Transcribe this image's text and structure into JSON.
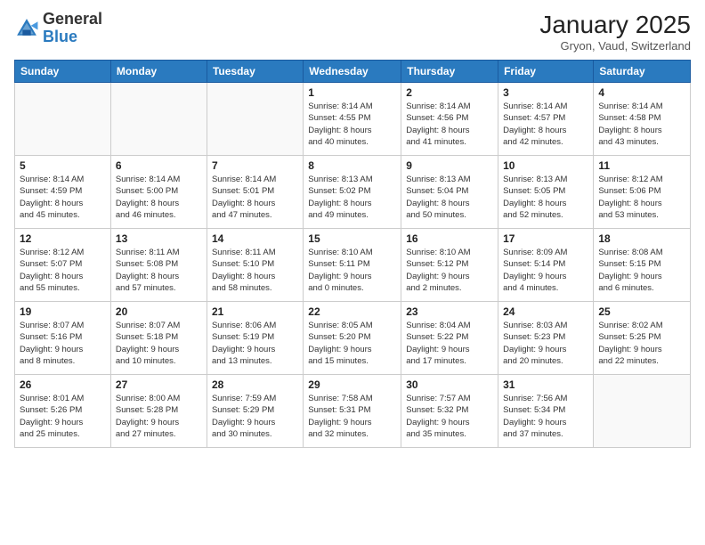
{
  "header": {
    "logo_general": "General",
    "logo_blue": "Blue",
    "month_title": "January 2025",
    "location": "Gryon, Vaud, Switzerland"
  },
  "days_of_week": [
    "Sunday",
    "Monday",
    "Tuesday",
    "Wednesday",
    "Thursday",
    "Friday",
    "Saturday"
  ],
  "weeks": [
    [
      {
        "day": "",
        "info": ""
      },
      {
        "day": "",
        "info": ""
      },
      {
        "day": "",
        "info": ""
      },
      {
        "day": "1",
        "info": "Sunrise: 8:14 AM\nSunset: 4:55 PM\nDaylight: 8 hours\nand 40 minutes."
      },
      {
        "day": "2",
        "info": "Sunrise: 8:14 AM\nSunset: 4:56 PM\nDaylight: 8 hours\nand 41 minutes."
      },
      {
        "day": "3",
        "info": "Sunrise: 8:14 AM\nSunset: 4:57 PM\nDaylight: 8 hours\nand 42 minutes."
      },
      {
        "day": "4",
        "info": "Sunrise: 8:14 AM\nSunset: 4:58 PM\nDaylight: 8 hours\nand 43 minutes."
      }
    ],
    [
      {
        "day": "5",
        "info": "Sunrise: 8:14 AM\nSunset: 4:59 PM\nDaylight: 8 hours\nand 45 minutes."
      },
      {
        "day": "6",
        "info": "Sunrise: 8:14 AM\nSunset: 5:00 PM\nDaylight: 8 hours\nand 46 minutes."
      },
      {
        "day": "7",
        "info": "Sunrise: 8:14 AM\nSunset: 5:01 PM\nDaylight: 8 hours\nand 47 minutes."
      },
      {
        "day": "8",
        "info": "Sunrise: 8:13 AM\nSunset: 5:02 PM\nDaylight: 8 hours\nand 49 minutes."
      },
      {
        "day": "9",
        "info": "Sunrise: 8:13 AM\nSunset: 5:04 PM\nDaylight: 8 hours\nand 50 minutes."
      },
      {
        "day": "10",
        "info": "Sunrise: 8:13 AM\nSunset: 5:05 PM\nDaylight: 8 hours\nand 52 minutes."
      },
      {
        "day": "11",
        "info": "Sunrise: 8:12 AM\nSunset: 5:06 PM\nDaylight: 8 hours\nand 53 minutes."
      }
    ],
    [
      {
        "day": "12",
        "info": "Sunrise: 8:12 AM\nSunset: 5:07 PM\nDaylight: 8 hours\nand 55 minutes."
      },
      {
        "day": "13",
        "info": "Sunrise: 8:11 AM\nSunset: 5:08 PM\nDaylight: 8 hours\nand 57 minutes."
      },
      {
        "day": "14",
        "info": "Sunrise: 8:11 AM\nSunset: 5:10 PM\nDaylight: 8 hours\nand 58 minutes."
      },
      {
        "day": "15",
        "info": "Sunrise: 8:10 AM\nSunset: 5:11 PM\nDaylight: 9 hours\nand 0 minutes."
      },
      {
        "day": "16",
        "info": "Sunrise: 8:10 AM\nSunset: 5:12 PM\nDaylight: 9 hours\nand 2 minutes."
      },
      {
        "day": "17",
        "info": "Sunrise: 8:09 AM\nSunset: 5:14 PM\nDaylight: 9 hours\nand 4 minutes."
      },
      {
        "day": "18",
        "info": "Sunrise: 8:08 AM\nSunset: 5:15 PM\nDaylight: 9 hours\nand 6 minutes."
      }
    ],
    [
      {
        "day": "19",
        "info": "Sunrise: 8:07 AM\nSunset: 5:16 PM\nDaylight: 9 hours\nand 8 minutes."
      },
      {
        "day": "20",
        "info": "Sunrise: 8:07 AM\nSunset: 5:18 PM\nDaylight: 9 hours\nand 10 minutes."
      },
      {
        "day": "21",
        "info": "Sunrise: 8:06 AM\nSunset: 5:19 PM\nDaylight: 9 hours\nand 13 minutes."
      },
      {
        "day": "22",
        "info": "Sunrise: 8:05 AM\nSunset: 5:20 PM\nDaylight: 9 hours\nand 15 minutes."
      },
      {
        "day": "23",
        "info": "Sunrise: 8:04 AM\nSunset: 5:22 PM\nDaylight: 9 hours\nand 17 minutes."
      },
      {
        "day": "24",
        "info": "Sunrise: 8:03 AM\nSunset: 5:23 PM\nDaylight: 9 hours\nand 20 minutes."
      },
      {
        "day": "25",
        "info": "Sunrise: 8:02 AM\nSunset: 5:25 PM\nDaylight: 9 hours\nand 22 minutes."
      }
    ],
    [
      {
        "day": "26",
        "info": "Sunrise: 8:01 AM\nSunset: 5:26 PM\nDaylight: 9 hours\nand 25 minutes."
      },
      {
        "day": "27",
        "info": "Sunrise: 8:00 AM\nSunset: 5:28 PM\nDaylight: 9 hours\nand 27 minutes."
      },
      {
        "day": "28",
        "info": "Sunrise: 7:59 AM\nSunset: 5:29 PM\nDaylight: 9 hours\nand 30 minutes."
      },
      {
        "day": "29",
        "info": "Sunrise: 7:58 AM\nSunset: 5:31 PM\nDaylight: 9 hours\nand 32 minutes."
      },
      {
        "day": "30",
        "info": "Sunrise: 7:57 AM\nSunset: 5:32 PM\nDaylight: 9 hours\nand 35 minutes."
      },
      {
        "day": "31",
        "info": "Sunrise: 7:56 AM\nSunset: 5:34 PM\nDaylight: 9 hours\nand 37 minutes."
      },
      {
        "day": "",
        "info": ""
      }
    ]
  ]
}
